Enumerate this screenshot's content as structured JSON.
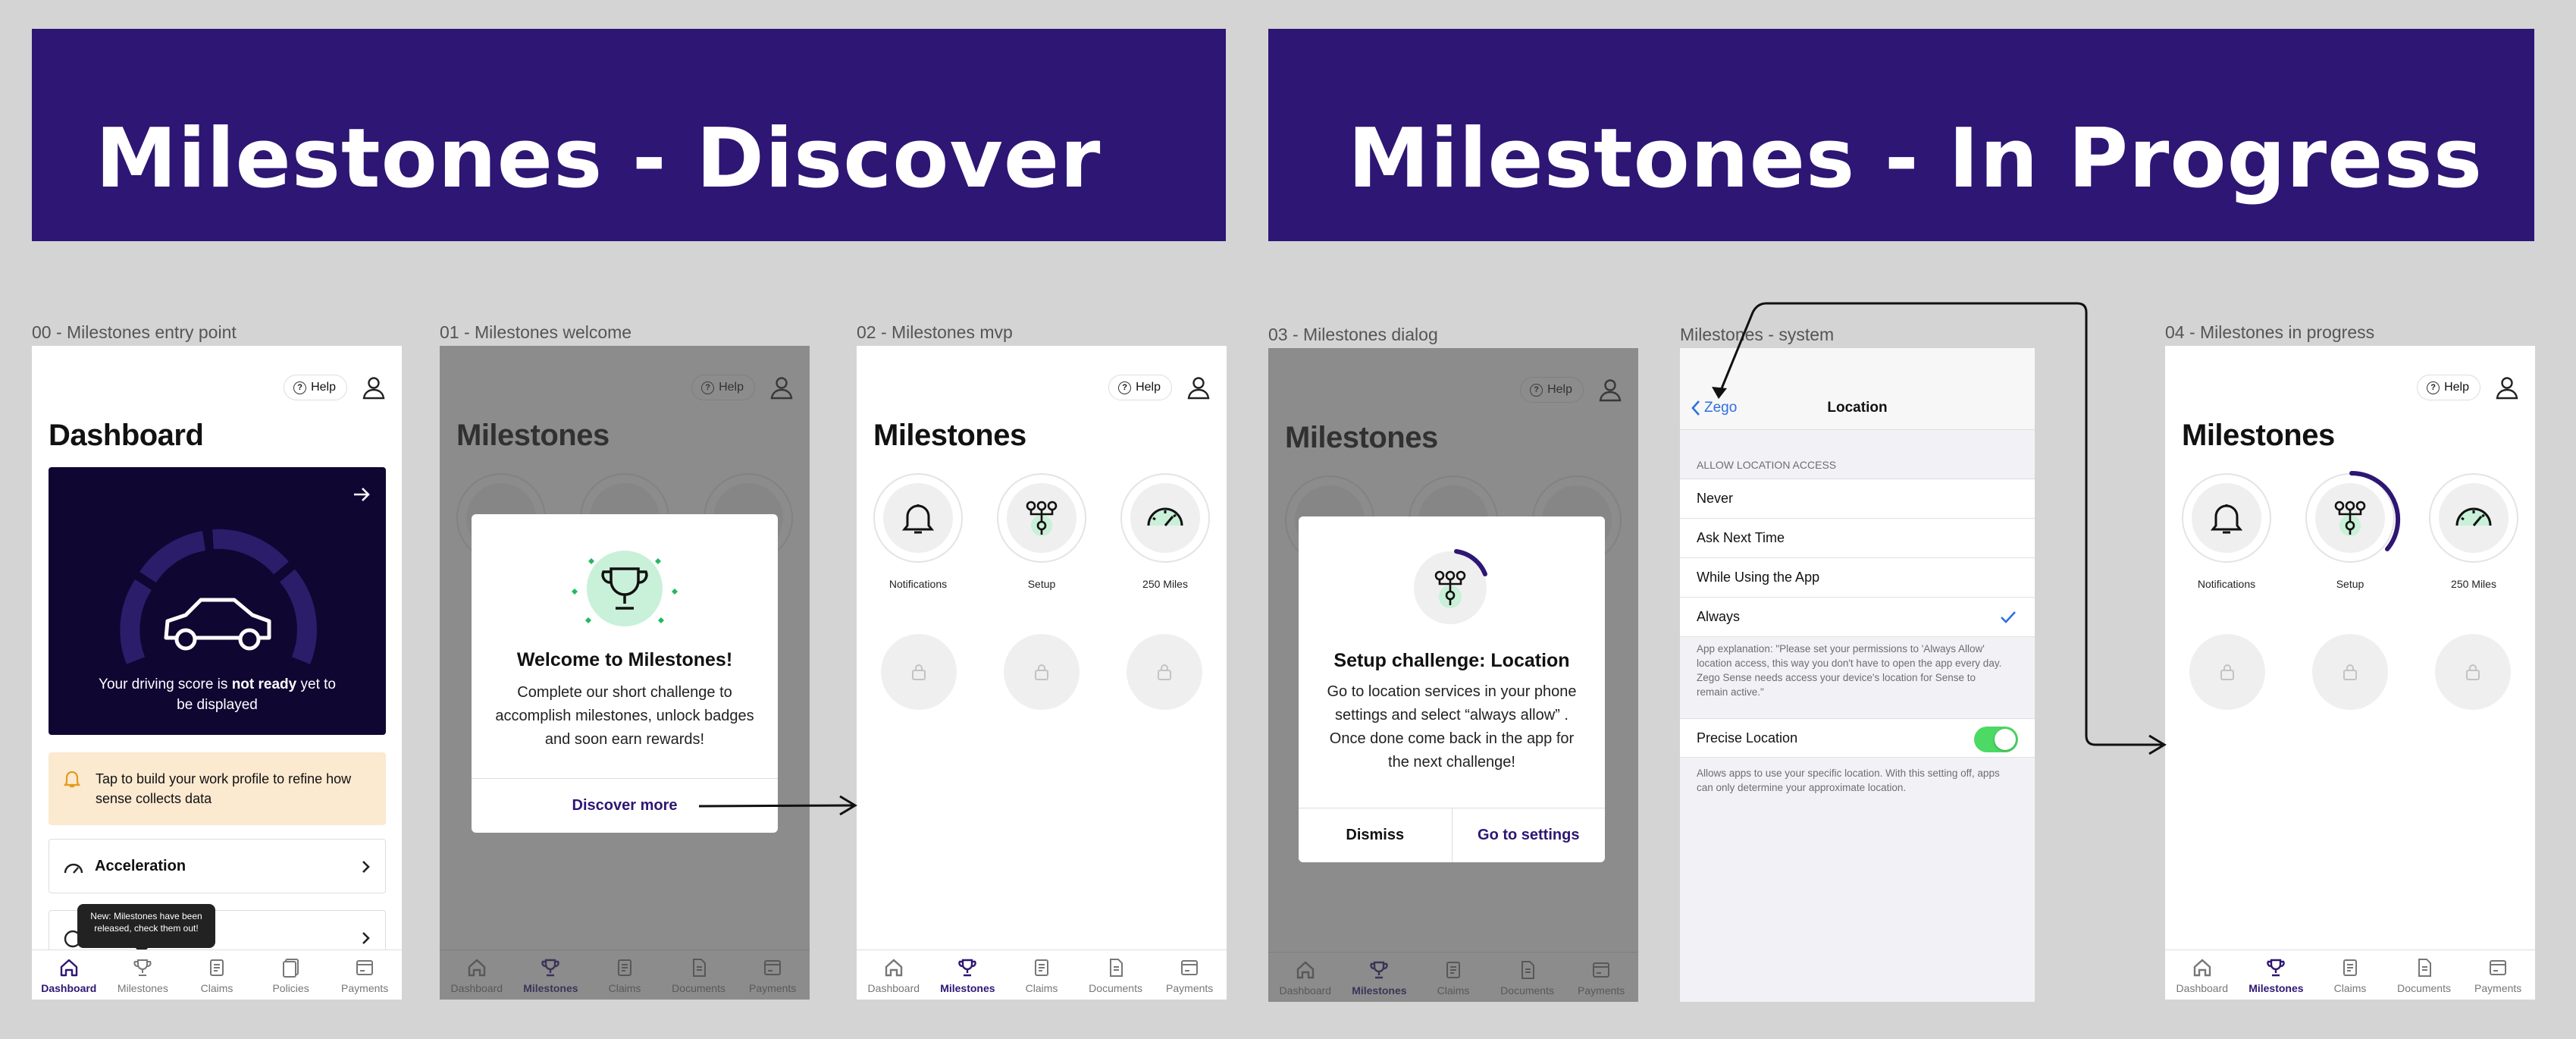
{
  "banners": {
    "discover": "Milestones - Discover",
    "in_progress": "Milestones - In Progress"
  },
  "frame_labels": {
    "f0": "00 - Milestones entry point",
    "f1": "01 - Milestones  welcome",
    "f2": "02 - Milestones mvp",
    "f3": "03 - Milestones dialog",
    "f4": "Milestones - system",
    "f5": "04 - Milestones in progress"
  },
  "header": {
    "help": "Help"
  },
  "tabs": [
    "Dashboard",
    "Milestones",
    "Claims",
    "Policies",
    "Documents",
    "Payments"
  ],
  "dashboard": {
    "title": "Dashboard",
    "score_text_prefix": "Your driving score is ",
    "score_text_bold": "not ready",
    "score_text_suffix": " yet to be displayed",
    "work_profile": "Tap to build your work profile to refine how sense collects data",
    "acceleration": "Acceleration",
    "tooltip": "New: Milestones have been released, check them out!",
    "tab_labels": [
      "Dashboard",
      "Milestones",
      "Claims",
      "Policies",
      "Payments"
    ]
  },
  "milestones": {
    "title": "Milestones",
    "badges": [
      "Notifications",
      "Setup",
      "250 Miles"
    ],
    "tab_labels": [
      "Dashboard",
      "Milestones",
      "Claims",
      "Documents",
      "Payments"
    ]
  },
  "welcome_dialog": {
    "title": "Welcome to Milestones!",
    "body": "Complete our short challenge to accomplish milestones, unlock badges and soon earn rewards!",
    "cta": "Discover more"
  },
  "setup_dialog": {
    "title": "Setup challenge: Location",
    "body": "Go to location services in your phone settings and select “always allow” . Once done come back in the app for the next challenge!",
    "dismiss": "Dismiss",
    "go_settings": "Go to settings"
  },
  "system": {
    "back": "Zego",
    "title": "Location",
    "section": "ALLOW LOCATION ACCESS",
    "options": [
      "Never",
      "Ask Next Time",
      "While Using the App",
      "Always"
    ],
    "selected": "Always",
    "explanation": "App explanation: \"Please set your permissions to 'Always Allow' location access, this way you don't have to open the app every day. Zego Sense needs access your device's location for Sense to remain active.\"",
    "precise": "Precise Location",
    "precise_on": true,
    "precise_note": "Allows apps to use your specific location. With this setting off, apps can only determine your approximate location."
  },
  "colors": {
    "brand": "#2e1674",
    "mint": "#c9f0d8",
    "toggle": "#4cd964",
    "warn_bg": "#fbe9d0"
  }
}
